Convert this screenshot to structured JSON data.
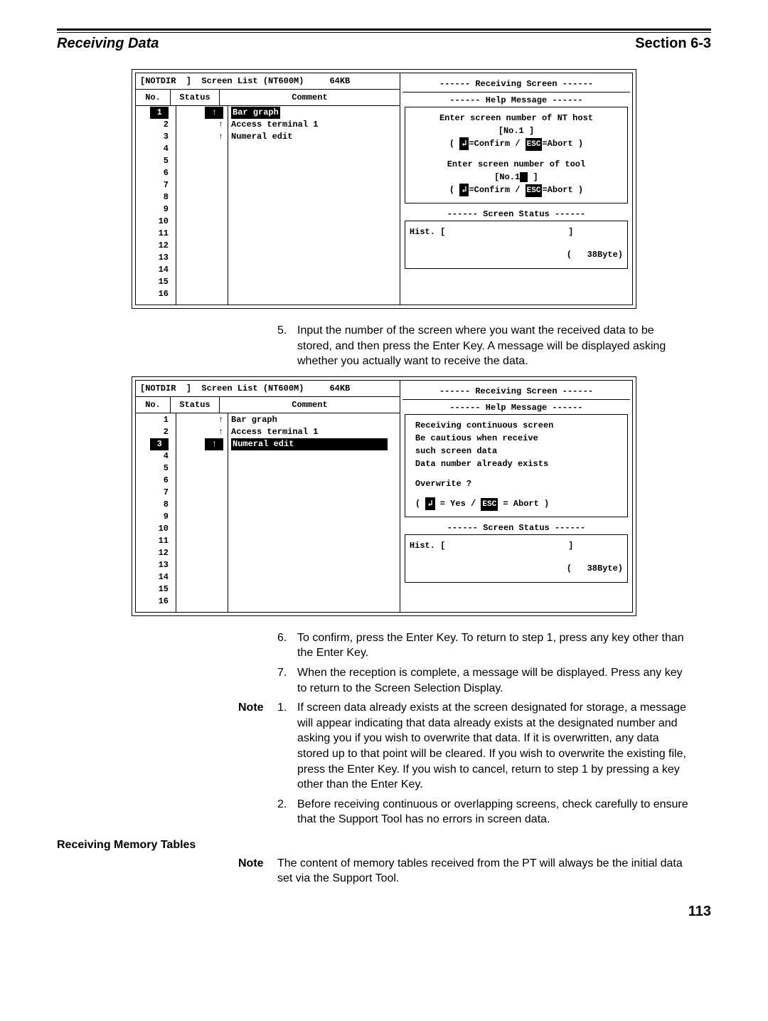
{
  "header": {
    "left": "Receiving Data",
    "right": "Section 6-3"
  },
  "screenshot1": {
    "title": "[NOTDIR  ]  Screen List (NT600M)     64KB",
    "right_title": "------ Receiving Screen ------",
    "cols": {
      "no": "No.",
      "status": "Status",
      "comment": "Comment"
    },
    "rows_no": "1\n2\n3\n4\n5\n6\n7\n8\n9\n10\n11\n12\n13\n14\n15\n16",
    "rows_status": "↑\n↑\n↑",
    "rows_comment_sel": "Bar graph",
    "rows_comment_rest": "Access terminal 1\nNumeral edit",
    "help_title": "------   Help Message    ------",
    "help_l1": "Enter screen number of NT host",
    "help_l2": "[No.1   ]",
    "help_l3a": "( ",
    "help_l3_key1": "↲",
    "help_l3b": "=Confirm / ",
    "help_l3_key2": "ESC",
    "help_l3c": "=Abort )",
    "help_l4": "Enter screen number of tool",
    "help_l5a": "[No.1",
    "help_l5b": " ]",
    "status_title": "------   Screen Status   ------",
    "hist": "Hist. [                        ]",
    "bytes": "(   38Byte)"
  },
  "step5": {
    "n": "5.",
    "t": "Input the number of the screen where you want the received data to be stored, and then press the Enter Key. A message will be displayed asking whether you actually want to receive the data."
  },
  "screenshot2": {
    "title": "[NOTDIR  ]  Screen List (NT600M)     64KB",
    "right_title": "------ Receiving Screen ------",
    "cols": {
      "no": "No.",
      "status": "Status",
      "comment": "Comment"
    },
    "rows_no": "1\n2\n3\n4\n5\n6\n7\n8\n9\n10\n11\n12\n13\n14\n15\n16",
    "rows_status": "↑\n↑\n↑",
    "rows_comment_pre": "Bar graph\nAccess terminal 1",
    "rows_comment_sel": "Numeral edit",
    "help_title": "------   Help Message    ------",
    "m1": "Receiving continuous screen",
    "m2": "Be cautious when receive",
    "m3": "such screen data",
    "m4": "Data number already exists",
    "m5": "Overwrite ?",
    "m6a": "( ",
    "m6_key1": "↲",
    "m6b": " = Yes / ",
    "m6_key2": "ESC",
    "m6c": " = Abort )",
    "status_title": "------   Screen Status   ------",
    "hist": "Hist. [                        ]",
    "bytes": "(   38Byte)"
  },
  "step6": {
    "n": "6.",
    "t": "To confirm, press the Enter Key. To return to step 1, press any key other than the Enter Key."
  },
  "step7": {
    "n": "7.",
    "t": "When the reception is complete, a message will be displayed. Press any key to return to the Screen Selection Display."
  },
  "note": {
    "label": "Note",
    "n1": "1.",
    "t1": "If screen data already exists at the screen designated for storage, a message will appear indicating that data already exists at the designated number and asking you if you wish to overwrite that data. If it is overwritten, any data stored up to that point will be cleared. If you wish to overwrite the existing file, press the Enter Key. If you wish to cancel, return to step 1 by pressing a key other than the Enter Key.",
    "n2": "2.",
    "t2": "Before receiving continuous or overlapping screens, check carefully to ensure that the Support Tool has no errors in screen data."
  },
  "subhead": "Receiving Memory Tables",
  "note2": {
    "label": "Note",
    "t": "The content of memory tables received from the PT will always be the initial data set via the Support Tool."
  },
  "pagenum": "113"
}
